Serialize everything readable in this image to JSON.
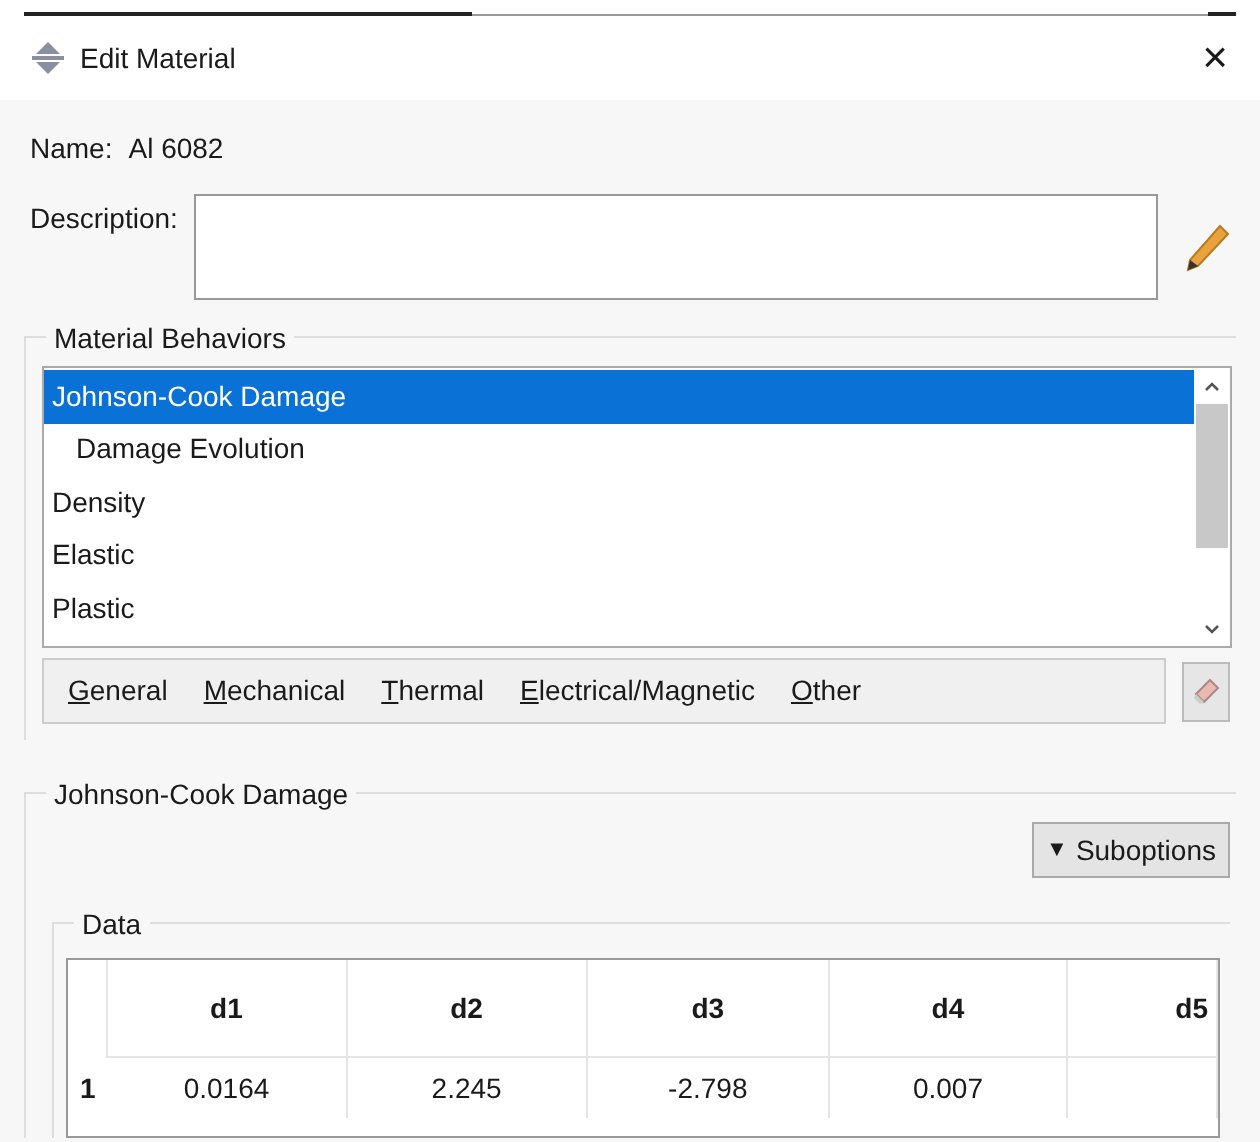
{
  "window": {
    "title": "Edit Material",
    "close": "×"
  },
  "name": {
    "label": "Name:",
    "value": "Al 6082"
  },
  "description": {
    "label": "Description:"
  },
  "material_behaviors": {
    "title": "Material Behaviors",
    "items": [
      {
        "label": "Johnson-Cook Damage",
        "selected": true,
        "children": [
          {
            "label": "Damage Evolution",
            "selected": false
          }
        ]
      },
      {
        "label": "Density",
        "selected": false
      },
      {
        "label": "Elastic",
        "selected": false
      },
      {
        "label": "Plastic",
        "selected": false
      }
    ]
  },
  "menu": [
    "General",
    "Mechanical",
    "Thermal",
    "Electrical/Magnetic",
    "Other"
  ],
  "behavior_panel": {
    "title": "Johnson-Cook Damage",
    "suboptions": {
      "arrow": "▼",
      "label": "Suboptions"
    },
    "data": {
      "title": "Data",
      "columns": [
        "d1",
        "d2",
        "d3",
        "d4",
        "d5"
      ],
      "rows": [
        {
          "label": "1",
          "cells": [
            "0.0164",
            "2.245",
            "-2.798",
            "0.007"
          ]
        }
      ]
    }
  }
}
